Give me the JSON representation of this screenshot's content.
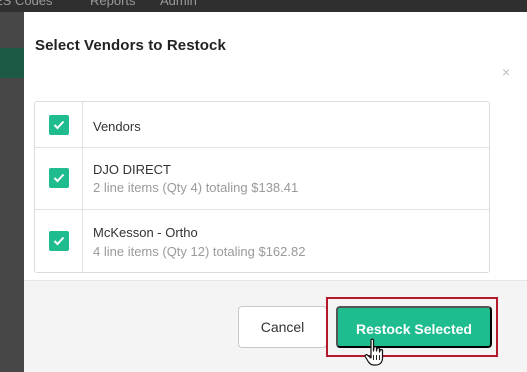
{
  "app_nav": {
    "items": [
      "ES Codes",
      "Reports",
      "Admin"
    ]
  },
  "modal": {
    "title": "Select Vendors to Restock",
    "close_glyph": "×",
    "list": {
      "header": {
        "label": "Vendors",
        "checked": true
      },
      "vendors": [
        {
          "name": "DJO DIRECT",
          "summary": "2 line items (Qty 4) totaling $138.41",
          "checked": true
        },
        {
          "name": "McKesson - Ortho",
          "summary": "4 line items (Qty 12) totaling $162.82",
          "checked": true
        }
      ]
    },
    "buttons": {
      "cancel": "Cancel",
      "restock": "Restock Selected"
    }
  },
  "icons": {
    "checkbox": "checkmark-icon",
    "close": "close-icon",
    "cursor": "hand-pointer-icon"
  },
  "colors": {
    "accent": "#1ebc8f",
    "highlight": "#b3182b",
    "overlay": "#474747"
  }
}
